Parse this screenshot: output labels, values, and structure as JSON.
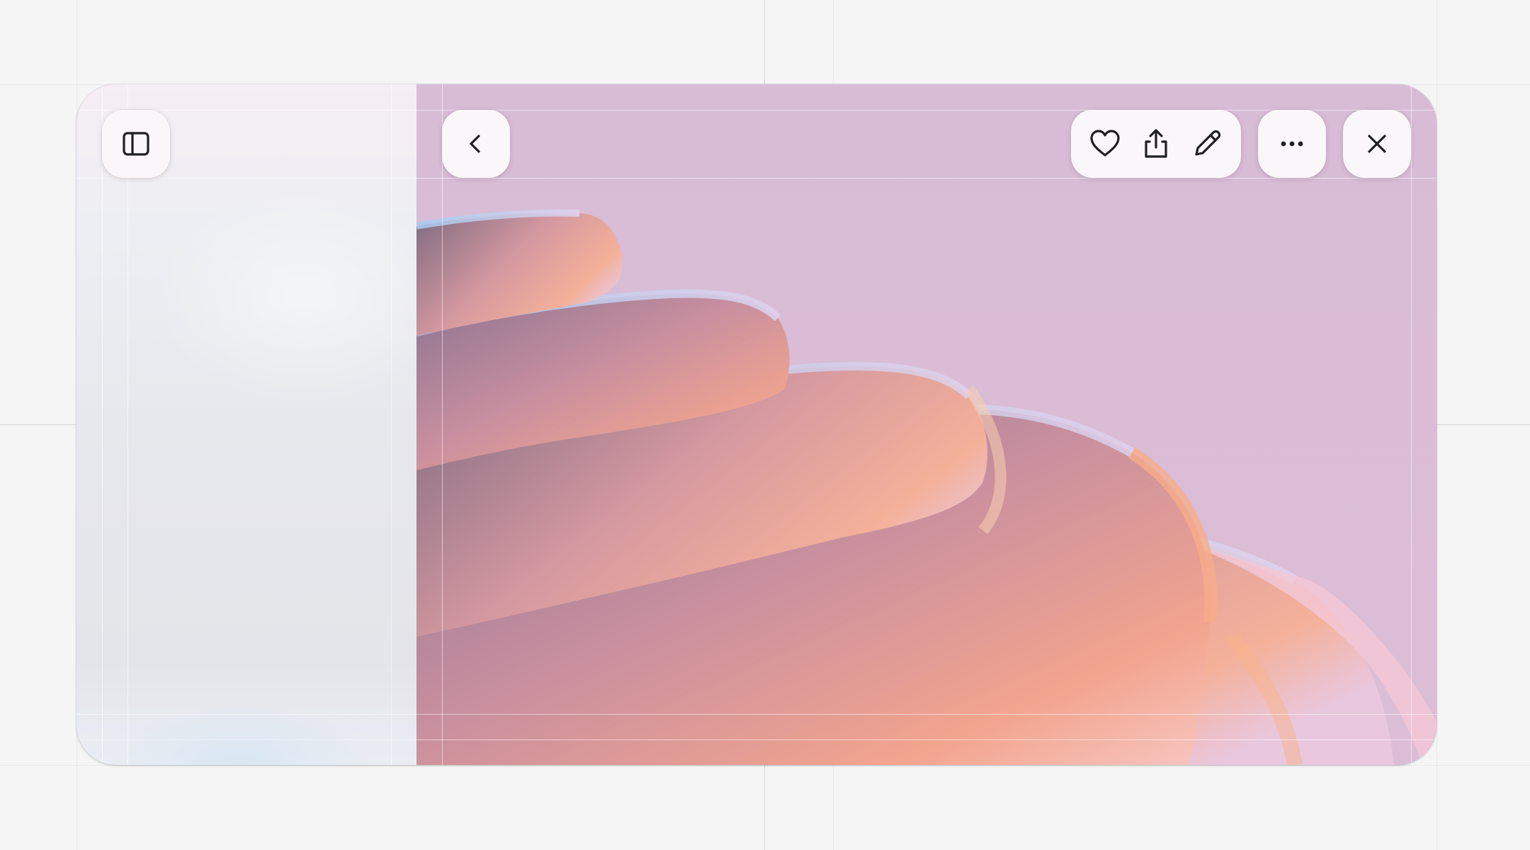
{
  "window": {
    "toolbar": {
      "sidebar_toggle": {
        "icon": "sidebar-icon"
      },
      "back": {
        "icon": "chevron-left-icon"
      },
      "actions": [
        {
          "id": "favorite",
          "icon": "heart-icon"
        },
        {
          "id": "share",
          "icon": "share-icon"
        },
        {
          "id": "edit",
          "icon": "pencil-icon"
        }
      ],
      "more": {
        "icon": "ellipsis-icon"
      },
      "close": {
        "icon": "close-icon"
      }
    },
    "content": {
      "image": "pink-orange-wavy-abstract-wallpaper"
    }
  },
  "colors": {
    "canvas": "#f5f5f5",
    "content_background": "#d8bcd6",
    "button_background": "#fbf6fa",
    "icon_stroke": "#1f1f22",
    "wave_peach": "#f2a48e",
    "wave_blue": "#a9cbef"
  }
}
